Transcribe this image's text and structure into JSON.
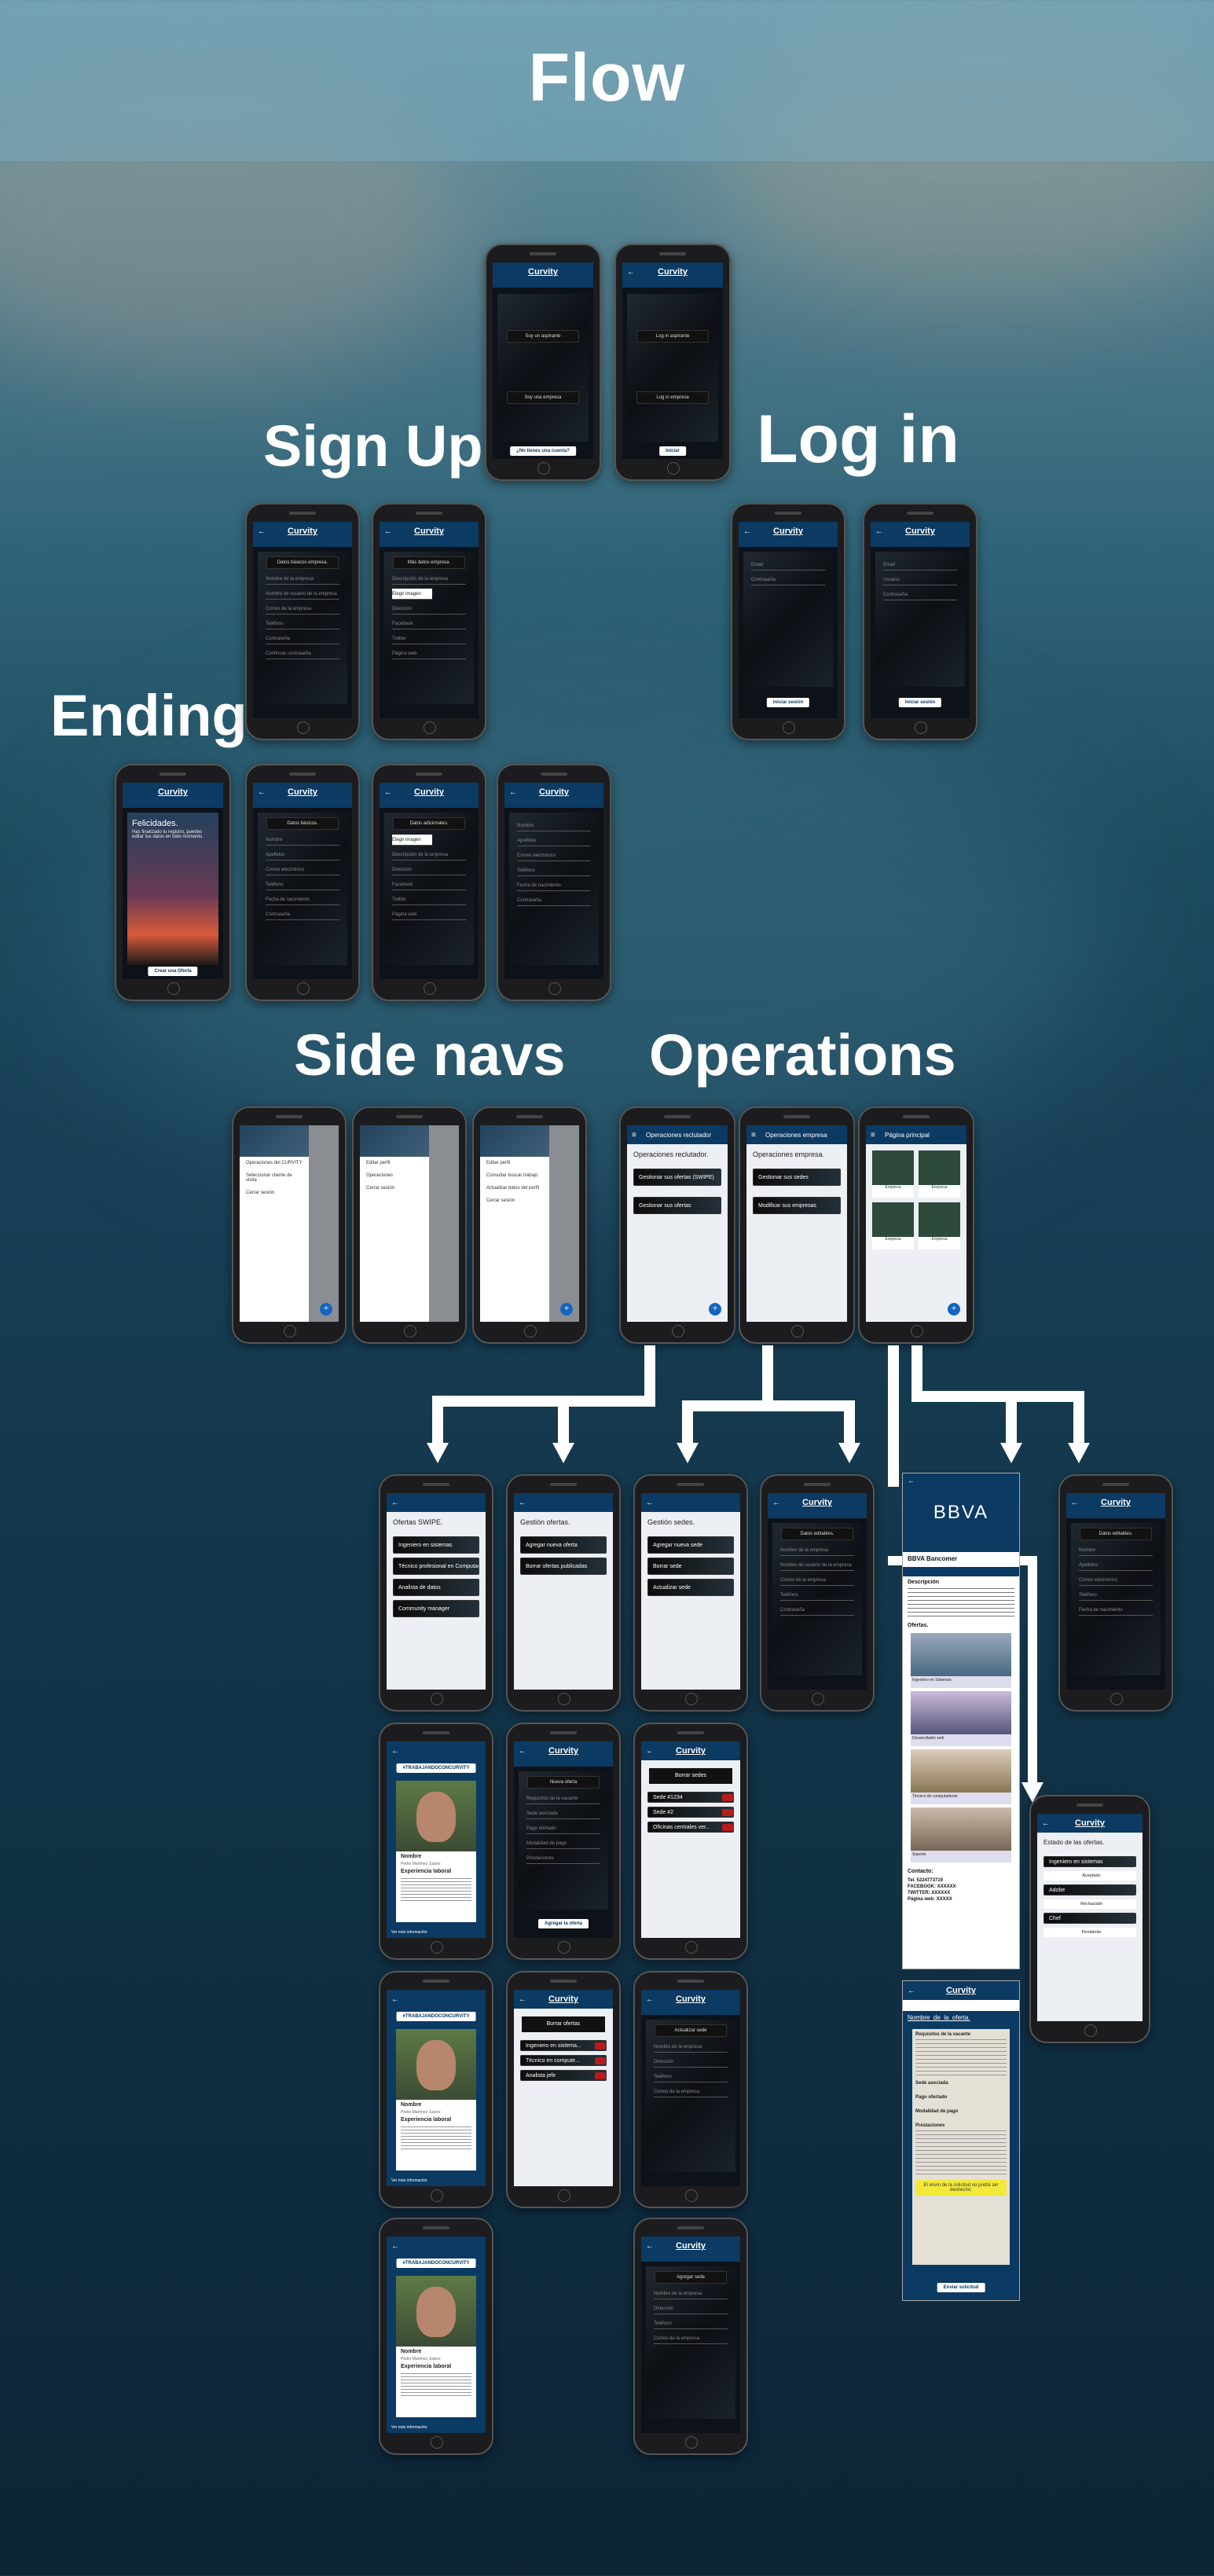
{
  "header": {
    "title": "Flow"
  },
  "sections": {
    "sign_up": "Sign Up",
    "log_in": "Log in",
    "ending": "Ending",
    "side_navs": "Side navs",
    "operations": "Operations"
  },
  "app": {
    "name": "Curvity"
  },
  "welcome": {
    "seeker_btn": "Soy un aspirante",
    "company_btn": "Soy una empresa",
    "no_account": "¿No tienes una cuenta?",
    "login_seeker": "Log in aspirante",
    "login_company": "Log in empresa",
    "login_btn": "Iniciar"
  },
  "signup": {
    "company_basic": "Datos básicos empresa.",
    "company_more": "Más datos empresa.",
    "fields_a": [
      "Nombre de la empresa",
      "Nombre de usuario de la empresa",
      "Correo de la empresa",
      "Teléfono",
      "Contraseña",
      "Confirmar contraseña"
    ],
    "fields_b": [
      "Descripción de la empresa",
      "Elegir imagen",
      "Dirección",
      "Facebook",
      "Twitter",
      "Página web"
    ]
  },
  "login": {
    "email": "Email",
    "password": "Contraseña",
    "user": "Usuario",
    "btn": "Iniciar sesión"
  },
  "ending": {
    "title": "Felicidades.",
    "text": "Has finalizado tu registro, puedes editar tus datos en todo momento.",
    "btn": "Crear una Oferta",
    "basic": "Datos básicos.",
    "additional": "Datos adicionales.",
    "fields": [
      "Nombre",
      "Apellidos",
      "Correo electrónico",
      "Teléfono",
      "Fecha de nacimiento",
      "Contraseña"
    ]
  },
  "sidenav": {
    "items_a": [
      "Operaciones del CURVITY",
      "Seleccionar cliente de visita",
      "Cerrar sesión"
    ],
    "items_b": [
      "Editar perfil",
      "Operaciones",
      "Cerrar sesión"
    ],
    "items_c": [
      "Editar perfil",
      "Consultar buscar trabajo",
      "Actualizar datos del perfil",
      "Cerrar sesión"
    ]
  },
  "operations": {
    "recruiter_bar": "Operaciones reclutador",
    "recruiter_title": "Operaciones reclutador.",
    "recruiter_btns": [
      "Gestionar sus ofertas (SWIPE)",
      "Gestionar sus ofertas"
    ],
    "company_bar": "Operaciones empresa",
    "company_title": "Operaciones empresa.",
    "company_btns": [
      "Gestionar sus sedes",
      "Modificar sus empresas"
    ],
    "home_bar": "Página principal",
    "home_cards": [
      "Empresa",
      "Empresa",
      "Empresa",
      "Empresa"
    ]
  },
  "detail": {
    "swipe_title": "Ofertas SWIPE.",
    "swipe_items": [
      "Ingeniero en sistemas",
      "Técnico profesional en Computación",
      "Analista de datos",
      "Community manager"
    ],
    "offers_title": "Gestión ofertas.",
    "offers_items": [
      "Agregar nueva oferta",
      "Borrar ofertas publicadas"
    ],
    "sedes_title": "Gestión sedes.",
    "sedes_items": [
      "Agregar nueva sede",
      "Borrar sede",
      "Actualizar sede"
    ],
    "editable": "Datos editables."
  },
  "company_profile": {
    "logo": "BBVA",
    "name": "BBVA Bancomer",
    "desc_label": "Descripción",
    "offers_label": "Ofertas.",
    "offers": [
      "Ingeniero en Sistemas",
      "Desarrollador web",
      "Técnico de computadoras",
      "Soporte"
    ],
    "contact_label": "Contacto:",
    "contact": [
      "Tel. 5224773719",
      "FACEBOOK: XXXXXX",
      "TWITTER: XXXXXX",
      "Página web: XXXXX"
    ]
  },
  "offer_detail": {
    "title": "Nombre_de_la_oferta.",
    "sections": [
      "Requisitos de la vacante",
      "Sede asociada",
      "Pago ofertado",
      "Modalidad de pago",
      "Prestaciones"
    ],
    "warning": "El envío de la solicitud no podrá ser deshecho.",
    "btn": "Enviar solicitud"
  },
  "status": {
    "title": "Estado de las ofertas.",
    "items": [
      "Ingeniero en sistemas",
      "Aceptado",
      "Adobe",
      "Rechazado",
      "Chef",
      "Pendiente"
    ]
  },
  "candidate": {
    "tag": "#TRABAJANDOCONCURVITY",
    "name_label": "Nombre",
    "name": "Pedro Martínez Juárez",
    "exp_label": "Experiencia laboral",
    "footer": "Ver más información"
  },
  "manage": {
    "new_offer": "Nueva oferta",
    "delete_sedes": "Borrar sedes",
    "sedes": [
      "Sede #1234",
      "Sede #2",
      "Oficinas centrales ver..."
    ],
    "delete_offers": "Borrar ofertas",
    "offers": [
      "Ingeniero en sistema...",
      "Técnico en compute...",
      "Analista jefe"
    ],
    "update_sede": "Actualizar sede",
    "add_sede": "Agregar sede",
    "publish": "Agregar la oferta"
  }
}
